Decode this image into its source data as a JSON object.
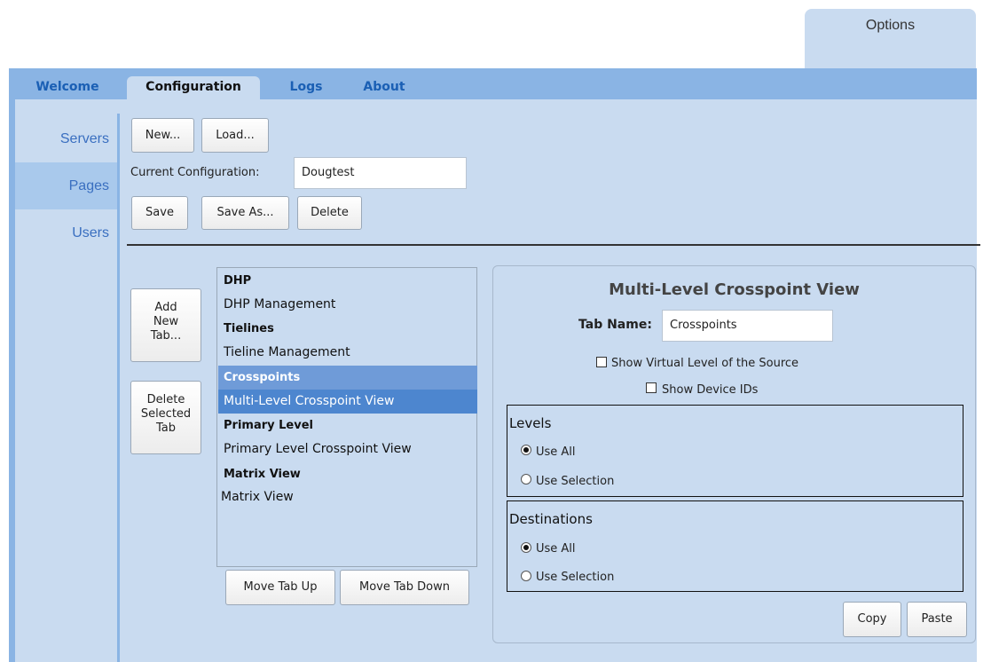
{
  "options_tab": "Options",
  "tabs": [
    "Welcome",
    "Configuration",
    "Logs",
    "About"
  ],
  "sidebar": [
    "Servers",
    "Pages",
    "Users"
  ],
  "config": {
    "new_label": "New...",
    "load_label": "Load...",
    "current_label": "Current Configuration:",
    "current_value": "Dougtest",
    "save_label": "Save",
    "save_as_label": "Save As...",
    "delete_label": "Delete"
  },
  "tab_buttons": {
    "add_new": [
      "Add",
      "New",
      "Tab..."
    ],
    "delete_selected": [
      "Delete",
      "Selected",
      "Tab"
    ],
    "move_up": "Move Tab Up",
    "move_down": "Move Tab Down"
  },
  "tab_list": [
    {
      "text": "DHP",
      "type": "group"
    },
    {
      "text": "DHP Management",
      "type": "item"
    },
    {
      "text": "Tielines",
      "type": "group"
    },
    {
      "text": "Tieline Management",
      "type": "item"
    },
    {
      "text": "Crosspoints",
      "type": "group",
      "selected": true
    },
    {
      "text": "Multi-Level Crosspoint View",
      "type": "item",
      "selected": true
    },
    {
      "text": "Primary Level",
      "type": "group"
    },
    {
      "text": "Primary Level Crosspoint View",
      "type": "item"
    },
    {
      "text": "Matrix View",
      "type": "group"
    },
    {
      "text": "Matrix View",
      "type": "item"
    }
  ],
  "panel": {
    "title": "Multi-Level Crosspoint View",
    "tab_name_label": "Tab Name:",
    "tab_name_value": "Crosspoints",
    "show_virtual": "Show Virtual Level of the Source",
    "show_device_ids": "Show Device IDs",
    "levels": {
      "title": "Levels",
      "use_all": "Use All",
      "use_selection": "Use Selection",
      "selected": "use_all"
    },
    "destinations": {
      "title": "Destinations",
      "use_all": "Use All",
      "use_selection": "Use Selection",
      "selected": "use_all"
    },
    "copy_label": "Copy",
    "paste_label": "Paste"
  }
}
